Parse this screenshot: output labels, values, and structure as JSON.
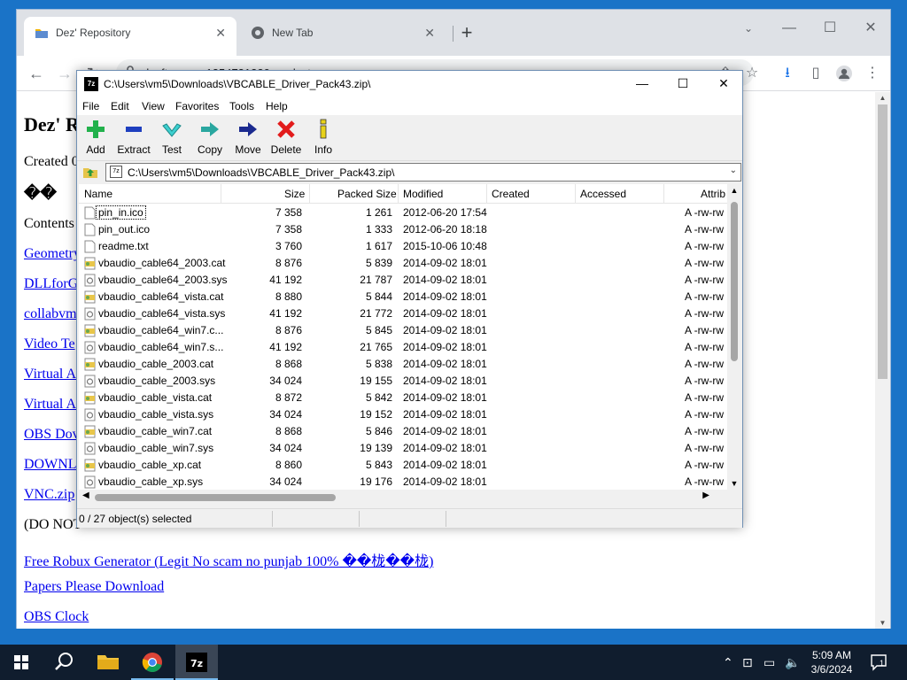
{
  "chrome": {
    "tabs": [
      {
        "label": "Dez' Repository",
        "active": true
      },
      {
        "label": "New Tab",
        "active": false
      }
    ],
    "url": "dezftpserver1354731320.on.drv.tw"
  },
  "page": {
    "heading": "Dez' R",
    "created": "Created 0",
    "garbled": "��",
    "contents": "Contents",
    "links": [
      "Geometry",
      "DLLforG",
      "collabvm",
      "Video Te",
      "Virtual A",
      "Virtual A",
      "OBS Dov",
      "DOWNL",
      "VNC.zip"
    ],
    "do_not": "(DO NOT",
    "link_robux": "Free Robux Generator (Legit No scam no punjab 100% ��栊��栊)",
    "link_papers": "Papers Please Download",
    "link_obs_clock": "OBS Clock"
  },
  "sevenzip": {
    "title": "C:\\Users\\vm5\\Downloads\\VBCABLE_Driver_Pack43.zip\\",
    "app_icon": "7z",
    "menu": [
      "File",
      "Edit",
      "View",
      "Favorites",
      "Tools",
      "Help"
    ],
    "toolbar": [
      {
        "label": "Add",
        "icon": "plus-icon"
      },
      {
        "label": "Extract",
        "icon": "minus-icon"
      },
      {
        "label": "Test",
        "icon": "check-icon"
      },
      {
        "label": "Copy",
        "icon": "copy-arrow-icon"
      },
      {
        "label": "Move",
        "icon": "move-arrow-icon"
      },
      {
        "label": "Delete",
        "icon": "delete-x-icon"
      },
      {
        "label": "Info",
        "icon": "info-icon"
      }
    ],
    "address": "C:\\Users\\vm5\\Downloads\\VBCABLE_Driver_Pack43.zip\\",
    "columns": [
      "Name",
      "Size",
      "Packed Size",
      "Modified",
      "Created",
      "Accessed",
      "Attrib"
    ],
    "files": [
      {
        "name": "pin_in.ico",
        "size": "7 358",
        "packed": "1 261",
        "modified": "2012-06-20 17:54",
        "attrib": "A -rw-rw",
        "type": "file"
      },
      {
        "name": "pin_out.ico",
        "size": "7 358",
        "packed": "1 333",
        "modified": "2012-06-20 18:18",
        "attrib": "A -rw-rw",
        "type": "file"
      },
      {
        "name": "readme.txt",
        "size": "3 760",
        "packed": "1 617",
        "modified": "2015-10-06 10:48",
        "attrib": "A -rw-rw",
        "type": "file"
      },
      {
        "name": "vbaudio_cable64_2003.cat",
        "size": "8 876",
        "packed": "5 839",
        "modified": "2014-09-02 18:01",
        "attrib": "A -rw-rw",
        "type": "cat"
      },
      {
        "name": "vbaudio_cable64_2003.sys",
        "size": "41 192",
        "packed": "21 787",
        "modified": "2014-09-02 18:01",
        "attrib": "A -rw-rw",
        "type": "sys"
      },
      {
        "name": "vbaudio_cable64_vista.cat",
        "size": "8 880",
        "packed": "5 844",
        "modified": "2014-09-02 18:01",
        "attrib": "A -rw-rw",
        "type": "cat"
      },
      {
        "name": "vbaudio_cable64_vista.sys",
        "size": "41 192",
        "packed": "21 772",
        "modified": "2014-09-02 18:01",
        "attrib": "A -rw-rw",
        "type": "sys"
      },
      {
        "name": "vbaudio_cable64_win7.c...",
        "size": "8 876",
        "packed": "5 845",
        "modified": "2014-09-02 18:01",
        "attrib": "A -rw-rw",
        "type": "cat"
      },
      {
        "name": "vbaudio_cable64_win7.s...",
        "size": "41 192",
        "packed": "21 765",
        "modified": "2014-09-02 18:01",
        "attrib": "A -rw-rw",
        "type": "sys"
      },
      {
        "name": "vbaudio_cable_2003.cat",
        "size": "8 868",
        "packed": "5 838",
        "modified": "2014-09-02 18:01",
        "attrib": "A -rw-rw",
        "type": "cat"
      },
      {
        "name": "vbaudio_cable_2003.sys",
        "size": "34 024",
        "packed": "19 155",
        "modified": "2014-09-02 18:01",
        "attrib": "A -rw-rw",
        "type": "sys"
      },
      {
        "name": "vbaudio_cable_vista.cat",
        "size": "8 872",
        "packed": "5 842",
        "modified": "2014-09-02 18:01",
        "attrib": "A -rw-rw",
        "type": "cat"
      },
      {
        "name": "vbaudio_cable_vista.sys",
        "size": "34 024",
        "packed": "19 152",
        "modified": "2014-09-02 18:01",
        "attrib": "A -rw-rw",
        "type": "sys"
      },
      {
        "name": "vbaudio_cable_win7.cat",
        "size": "8 868",
        "packed": "5 846",
        "modified": "2014-09-02 18:01",
        "attrib": "A -rw-rw",
        "type": "cat"
      },
      {
        "name": "vbaudio_cable_win7.sys",
        "size": "34 024",
        "packed": "19 139",
        "modified": "2014-09-02 18:01",
        "attrib": "A -rw-rw",
        "type": "sys"
      },
      {
        "name": "vbaudio_cable_xp.cat",
        "size": "8 860",
        "packed": "5 843",
        "modified": "2014-09-02 18:01",
        "attrib": "A -rw-rw",
        "type": "cat"
      },
      {
        "name": "vbaudio_cable_xp.sys",
        "size": "34 024",
        "packed": "19 176",
        "modified": "2014-09-02 18:01",
        "attrib": "A -rw-rw",
        "type": "sys"
      }
    ],
    "status": "0 / 27 object(s) selected"
  },
  "taskbar": {
    "time": "5:09 AM",
    "date": "3/6/2024",
    "notifications": "1"
  },
  "colors": {
    "desktop": "#1a73c7",
    "taskbar": "#101d2e",
    "link": "#0000ee"
  }
}
